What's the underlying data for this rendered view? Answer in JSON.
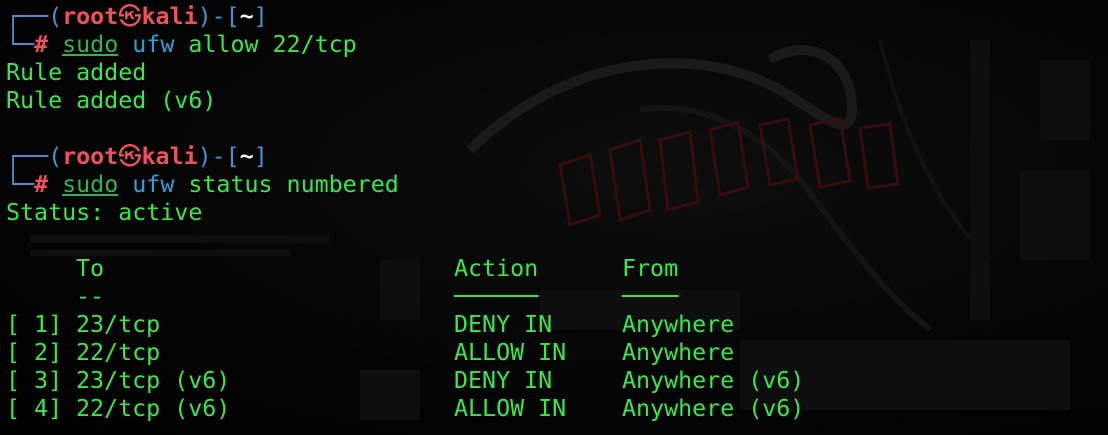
{
  "prompt": {
    "user": "root",
    "at_symbol": "㉿",
    "host": "kali",
    "dir": "~",
    "hash": "#"
  },
  "commands": [
    {
      "sudo": "sudo",
      "cmd": "ufw",
      "args": "allow 22/tcp",
      "output": [
        "Rule added",
        "Rule added (v6)"
      ]
    },
    {
      "sudo": "sudo",
      "cmd": "ufw",
      "args": "status numbered",
      "output": [
        "Status: active"
      ]
    }
  ],
  "table": {
    "headers": {
      "to": "To",
      "action": "Action",
      "from": "From"
    },
    "underlines": {
      "to": "--",
      "action": "──────",
      "from": "────"
    },
    "rows": [
      {
        "num": "[ 1]",
        "to": "23/tcp",
        "action": "DENY IN",
        "from": "Anywhere"
      },
      {
        "num": "[ 2]",
        "to": "22/tcp",
        "action": "ALLOW IN",
        "from": "Anywhere"
      },
      {
        "num": "[ 3]",
        "to": "23/tcp (v6)",
        "action": "DENY IN",
        "from": "Anywhere (v6)"
      },
      {
        "num": "[ 4]",
        "to": "22/tcp (v6)",
        "action": "ALLOW IN",
        "from": "Anywhere (v6)"
      }
    ]
  },
  "colors": {
    "output_green": "#38e84a",
    "prompt_red": "#f0505c",
    "prompt_blue": "#4a8fd6",
    "command_cyan": "#2f9fd8",
    "background": "#000000"
  },
  "background_art": "kali-linux-dragon-wallpaper"
}
